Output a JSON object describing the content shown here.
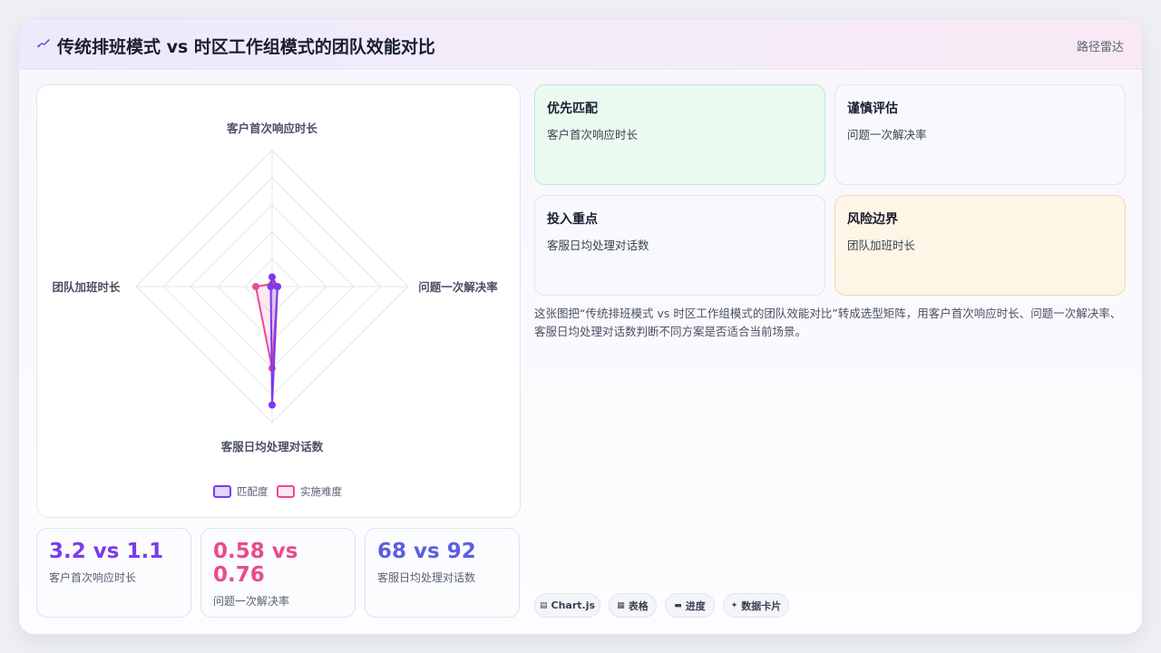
{
  "header": {
    "title": "传统排班模式 vs 时区工作组模式的团队效能对比",
    "badge": "路径雷达"
  },
  "colors": {
    "match": "#7c3aed",
    "difficulty": "#ec4899",
    "stat1": "#7c3aed",
    "stat2": "#e94b8c",
    "stat3": "#5b5fe0",
    "tile_green_bg": "#ebfaf1",
    "tile_green_border": "#b8ebcd",
    "tile_orange_bg": "#fff5e6",
    "tile_orange_border": "#f3d6a6"
  },
  "chart_data": {
    "type": "radar",
    "axes": [
      "客户首次响应时长",
      "问题一次解决率",
      "客服日均处理对话数",
      "团队加班时长"
    ],
    "rmax": 100,
    "grid_levels": 5,
    "grid": true,
    "legend_position": "bottom",
    "series": [
      {
        "name": "匹配度",
        "values": [
          7,
          4,
          87,
          1
        ]
      },
      {
        "name": "实施难度",
        "values": [
          2,
          4,
          60,
          12
        ]
      }
    ]
  },
  "stats": [
    {
      "value": "3.2 vs 1.1",
      "label": "客户首次响应时长"
    },
    {
      "value": "0.58 vs 0.76",
      "label": "问题一次解决率"
    },
    {
      "value": "68 vs 92",
      "label": "客服日均处理对话数"
    }
  ],
  "tiles": [
    {
      "title": "优先匹配",
      "text": "客户首次响应时长"
    },
    {
      "title": "谨慎评估",
      "text": "问题一次解决率"
    },
    {
      "title": "投入重点",
      "text": "客服日均处理对话数"
    },
    {
      "title": "风险边界",
      "text": "团队加班时长"
    }
  ],
  "description": "这张图把“传统排班模式 vs 时区工作组模式的团队效能对比”转成选型矩阵，用客户首次响应时长、问题一次解决率、客服日均处理对话数判断不同方案是否适合当前场景。",
  "pills": [
    {
      "icon": "chart-icon",
      "label": "Chart.js"
    },
    {
      "icon": "table-icon",
      "label": "表格"
    },
    {
      "icon": "progress-icon",
      "label": "进度"
    },
    {
      "icon": "sparkle-icon",
      "label": "数据卡片"
    }
  ]
}
